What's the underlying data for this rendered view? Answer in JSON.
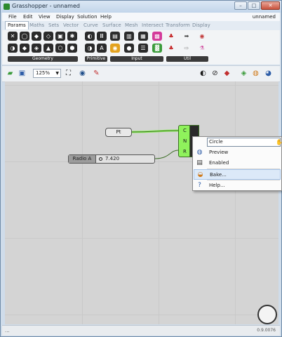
{
  "window": {
    "title": "Grasshopper - unnamed",
    "minimize": "–",
    "maximize": "□",
    "close": "✕"
  },
  "menubar": {
    "items": [
      "File",
      "Edit",
      "View",
      "Display",
      "Solution",
      "Help"
    ],
    "document_name": "unnamed"
  },
  "tabs": [
    "Params",
    "Maths",
    "Sets",
    "Vector",
    "Curve",
    "Surface",
    "Mesh",
    "Intersect",
    "Transform",
    "Display"
  ],
  "ribbon": {
    "groups": [
      "Geometry",
      "Primitive",
      "Input",
      "Util"
    ]
  },
  "toolbar": {
    "zoom": "125%"
  },
  "canvas": {
    "pt_param": "Pt",
    "slider": {
      "name": "Radio A",
      "value": "7.420"
    },
    "circle_inputs": [
      "C",
      "N",
      "R"
    ]
  },
  "context_menu": {
    "name_field": "Circle",
    "items": [
      "Preview",
      "Enabled",
      "Bake...",
      "Help..."
    ],
    "highlighted": "Bake..."
  },
  "status": {
    "left": "...",
    "version": "0.9.0076"
  },
  "colors": {
    "component": "#8ff25c",
    "canvas": "#d4d4d4",
    "highlight": "#dce9f8"
  }
}
